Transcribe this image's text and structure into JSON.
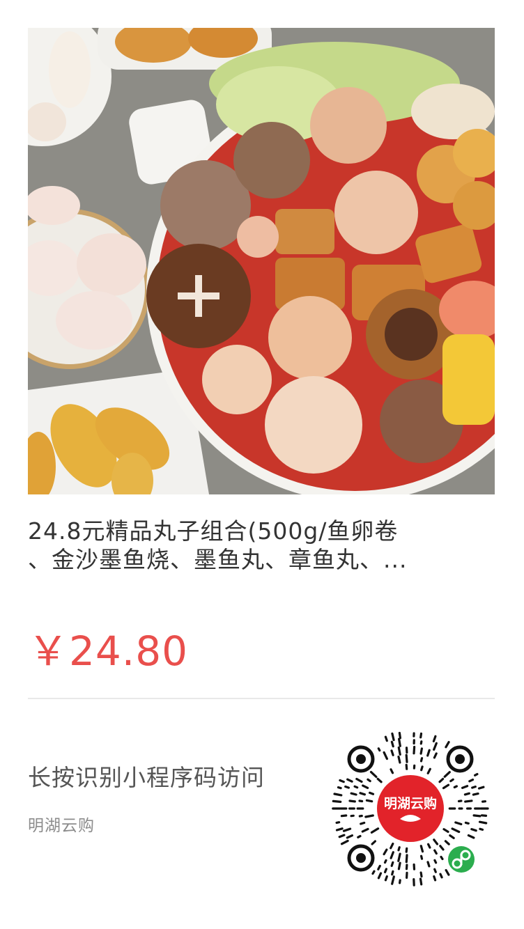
{
  "product": {
    "image_alt": "hotpot meatball combo",
    "title_line1": "24.8元精品丸子组合(500g/鱼卵卷",
    "title_line2": "、金沙墨鱼烧、墨鱼丸、章鱼丸、...",
    "price": "￥24.80"
  },
  "footer": {
    "hint": "长按识别小程序码访问",
    "store_name": "明湖云购"
  },
  "qr_code": {
    "center_label": "明湖云购",
    "badge_icon": "wechat-miniprogram-icon"
  },
  "colors": {
    "price": "#e94f4c",
    "qr_center": "#e2232a",
    "badge": "#2bad4e"
  }
}
